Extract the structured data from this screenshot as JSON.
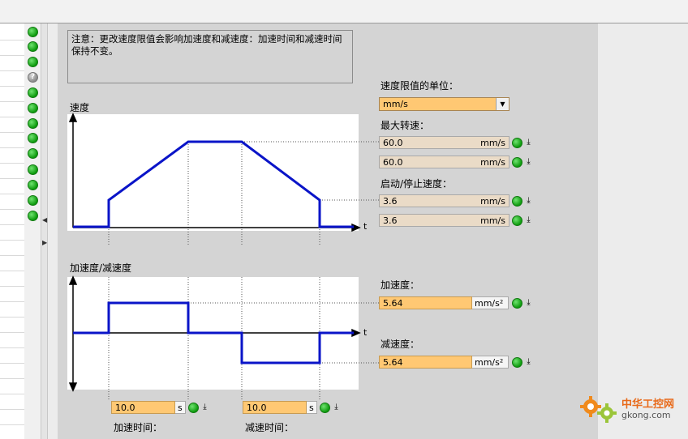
{
  "note": {
    "text": "注意：更改速度限值会影响加速度和减速度：加速时间和减速时间保持不变。"
  },
  "unit_select": {
    "label": "速度限值的单位：",
    "value": "mm/s"
  },
  "speed_chart": {
    "title": "速度",
    "axis_label": "t"
  },
  "accel_chart": {
    "title": "加速度/减速度",
    "axis_label": "t"
  },
  "max_speed": {
    "label": "最大转速：",
    "fields": [
      {
        "value": "60.0",
        "unit": "mm/s"
      },
      {
        "value": "60.0",
        "unit": "mm/s"
      }
    ]
  },
  "start_stop_speed": {
    "label": "启动/停止速度：",
    "fields": [
      {
        "value": "3.6",
        "unit": "mm/s"
      },
      {
        "value": "3.6",
        "unit": "mm/s"
      }
    ]
  },
  "acceleration": {
    "label": "加速度：",
    "value": "5.64",
    "unit": "mm/s²"
  },
  "deceleration": {
    "label": "减速度：",
    "value": "5.64",
    "unit": "mm/s²"
  },
  "accel_time": {
    "label": "加速时间：",
    "value": "10.0",
    "unit": "s"
  },
  "decel_time": {
    "label": "减速时间：",
    "value": "10.0",
    "unit": "s"
  },
  "watermark": {
    "cn": "中华工控网",
    "en": "gkong.com"
  },
  "colors": {
    "curve": "#0a14c8",
    "input_active": "#ffc873",
    "input_readonly": "#eadbc7",
    "status_ok": "#13a813",
    "panel": "#d4d4d4"
  },
  "icons": {
    "status": "green-status-icon",
    "unknown": "question-icon",
    "download": "download-icon",
    "dropdown": "chevron-down-icon"
  }
}
